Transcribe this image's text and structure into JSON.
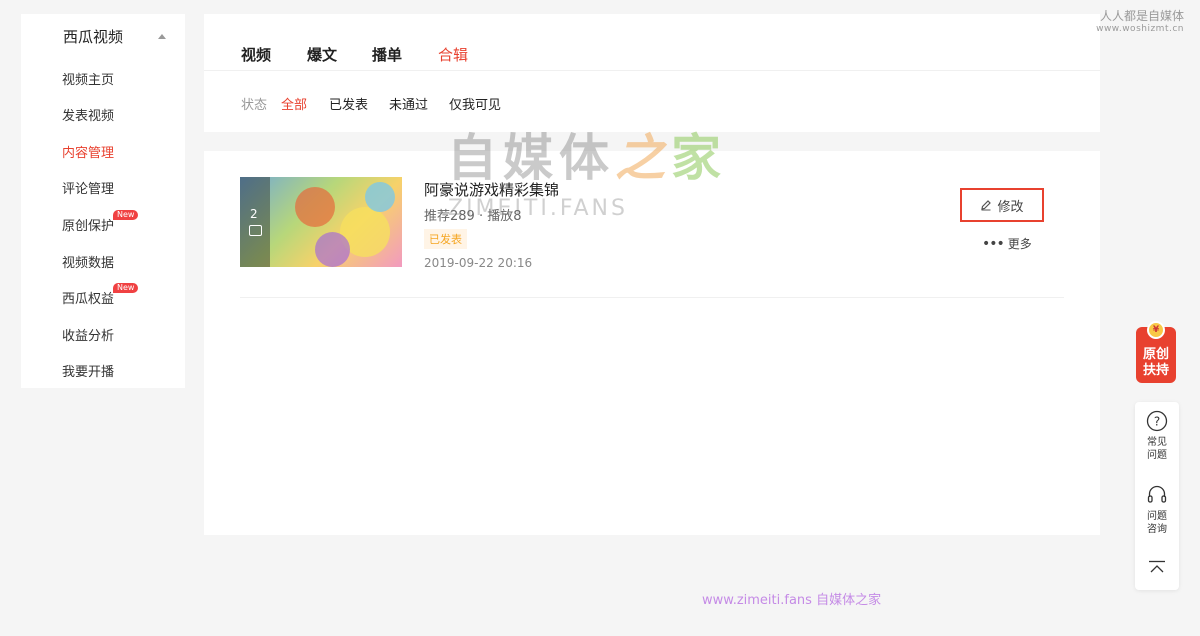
{
  "sidebar": {
    "title": "西瓜视频",
    "items": [
      {
        "label": "视频主页"
      },
      {
        "label": "发表视频"
      },
      {
        "label": "内容管理"
      },
      {
        "label": "评论管理"
      },
      {
        "label": "原创保护",
        "badge": "New"
      },
      {
        "label": "视频数据"
      },
      {
        "label": "西瓜权益",
        "badge": "New"
      },
      {
        "label": "收益分析"
      },
      {
        "label": "我要开播"
      }
    ],
    "active_label": "内容管理"
  },
  "tabs": [
    {
      "label": "视频"
    },
    {
      "label": "爆文"
    },
    {
      "label": "播单"
    },
    {
      "label": "合辑"
    }
  ],
  "active_tab": "合辑",
  "filters": {
    "label": "状态",
    "options": [
      "全部",
      "已发表",
      "未通过",
      "仅我可见"
    ],
    "active": "全部"
  },
  "item": {
    "thumb_count": "2",
    "title": "阿豪说游戏精彩集锦",
    "stats": "推荐289 · 播放8",
    "status": "已发表",
    "date": "2019-09-22 20:16",
    "edit_label": "修改",
    "more_label": "更多"
  },
  "watermarks": {
    "top_line1": "人人都是自媒体",
    "top_line2": "www.woshizmt.cn",
    "center_part1": "自媒体",
    "center_part2": "之",
    "center_part3": "家",
    "center_sub": "ZIMEITI.FANS",
    "bottom": "www.zimeiti.fans 自媒体之家"
  },
  "right_rail": {
    "promo_line1": "原创",
    "promo_line2": "扶持",
    "promo_coin": "¥",
    "faq_line1": "常见",
    "faq_line2": "问题",
    "consult_line1": "问题",
    "consult_line2": "咨询"
  },
  "colors": {
    "accent": "#e8412f",
    "badge": "#f04142",
    "status": "#f5a623"
  }
}
